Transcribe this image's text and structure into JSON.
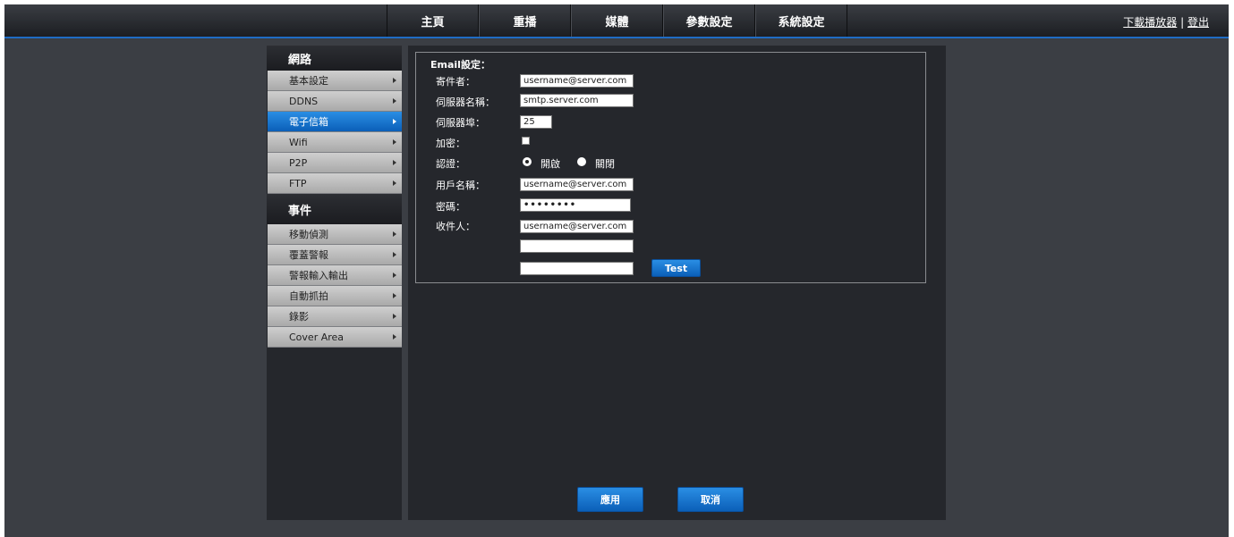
{
  "nav": {
    "items": [
      "主頁",
      "重播",
      "媒體",
      "參數設定",
      "系統設定"
    ],
    "download_link": "下載播放器",
    "separator": "|",
    "logout_link": "登出"
  },
  "sidebar": {
    "network_heading": "網路",
    "network_items": [
      "基本設定",
      "DDNS",
      "電子信箱",
      "Wifi",
      "P2P",
      "FTP"
    ],
    "active_item": "電子信箱",
    "event_heading": "事件",
    "event_items": [
      "移動偵測",
      "覆蓋警報",
      "警報輸入輸出",
      "自動抓拍",
      "錄影",
      "Cover Area"
    ]
  },
  "email": {
    "legend": "Email設定：",
    "sender_label": "寄件者：",
    "sender_value": "username@server.com",
    "server_label": "伺服器名稱：",
    "server_value": "smtp.server.com",
    "port_label": "伺服器埠：",
    "port_value": "25",
    "encrypt_label": "加密：",
    "auth_label": "認證：",
    "auth_on_label": "開啟",
    "auth_off_label": "關閉",
    "auth_selected": "開啟",
    "username_label": "用戶名稱：",
    "username_value": "username@server.com",
    "password_label": "密碼：",
    "password_value": "••••••••",
    "recipient_label": "收件人：",
    "recipient1_value": "username@server.com",
    "recipient2_value": "",
    "recipient3_value": "",
    "test_button": "Test"
  },
  "actions": {
    "apply_button": "應用",
    "cancel_button": "取消"
  },
  "colors": {
    "accent": "#1f6cc4",
    "background": "#3b3e44",
    "panel": "#25272c"
  }
}
